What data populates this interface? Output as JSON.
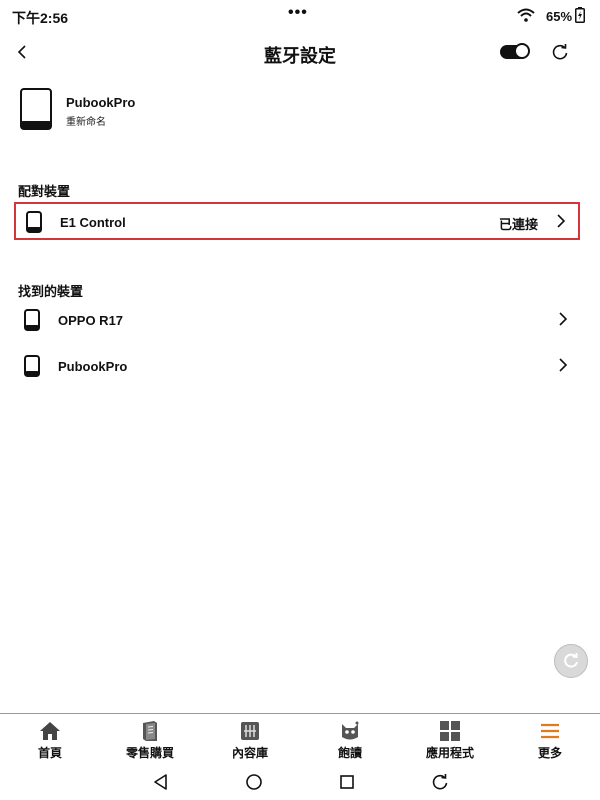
{
  "status_bar": {
    "time": "下午2:56",
    "dots": "•••",
    "battery_percent": "65%",
    "battery_level": 0.65
  },
  "header": {
    "title": "藍牙設定",
    "bluetooth_enabled": true
  },
  "device": {
    "name": "PubookPro",
    "rename_label": "重新命名"
  },
  "paired_section": {
    "label": "配對裝置",
    "items": [
      {
        "name": "E1 Control",
        "status": "已連接"
      }
    ]
  },
  "found_section": {
    "label": "找到的裝置",
    "items": [
      {
        "name": "OPPO R17"
      },
      {
        "name": "PubookPro"
      }
    ]
  },
  "bottom_nav": {
    "items": [
      {
        "label": "首頁",
        "icon": "home-icon"
      },
      {
        "label": "零售購買",
        "icon": "book-icon"
      },
      {
        "label": "內容庫",
        "icon": "library-icon"
      },
      {
        "label": "飽讀",
        "icon": "mascot-icon"
      },
      {
        "label": "應用程式",
        "icon": "apps-grid-icon"
      },
      {
        "label": "更多",
        "icon": "menu-icon"
      }
    ],
    "accent_color": "#e07a1f"
  }
}
